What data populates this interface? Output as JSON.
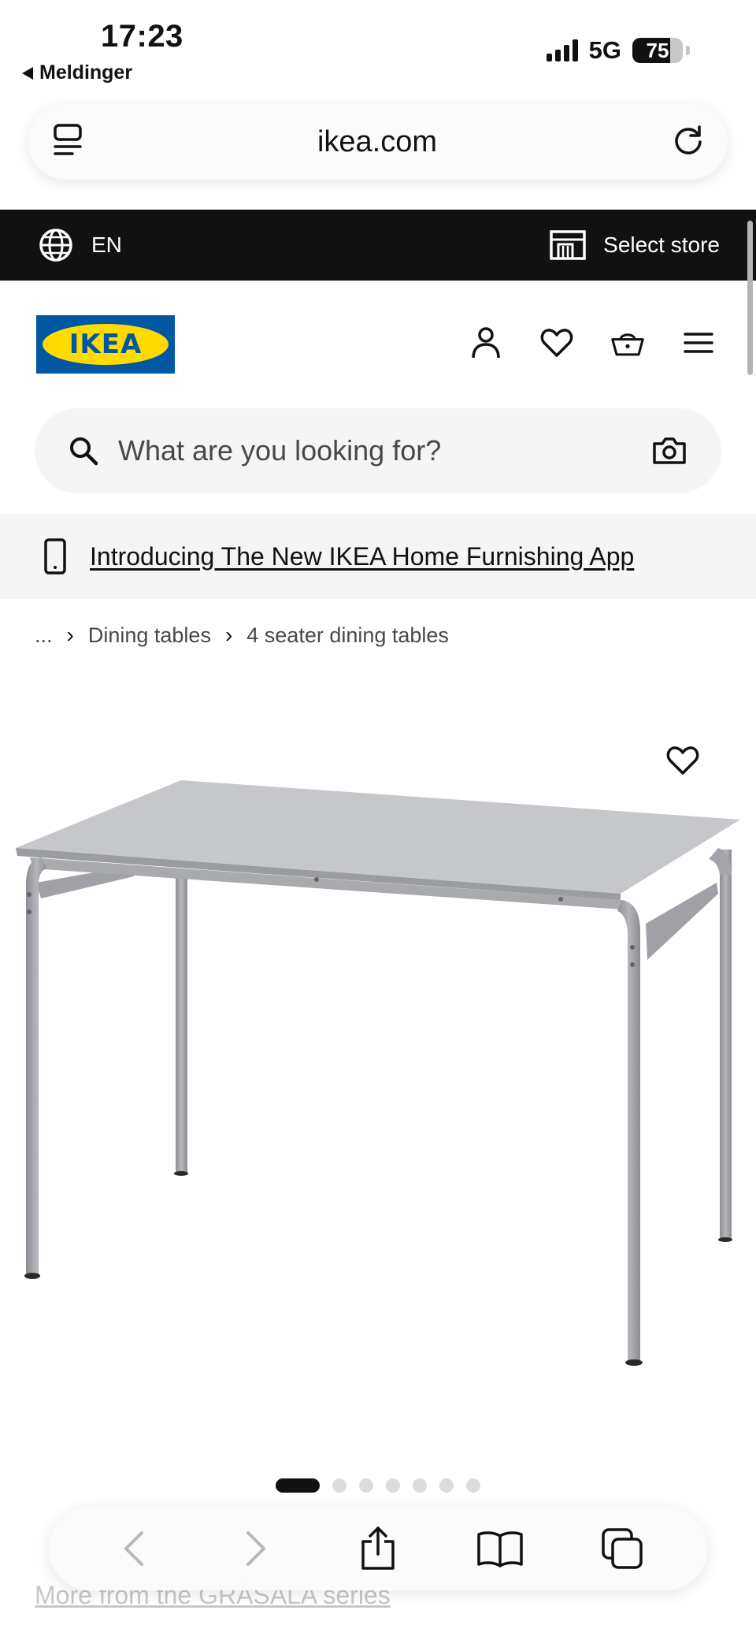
{
  "status_bar": {
    "time": "17:23",
    "back_label": "Meldinger",
    "network": "5G",
    "battery": "75",
    "battery_level": 0.75
  },
  "browser": {
    "url": "ikea.com"
  },
  "top_bar": {
    "language": "EN",
    "store_label": "Select store"
  },
  "header": {
    "logo_text": "IKEA",
    "icons": [
      "account-icon",
      "heart-icon",
      "basket-icon",
      "menu-icon"
    ]
  },
  "search": {
    "placeholder": "What are you looking for?"
  },
  "app_banner": {
    "text": "Introducing The New IKEA Home Furnishing App"
  },
  "breadcrumb": {
    "ellipsis": "...",
    "items": [
      "Dining tables",
      "4 seater dining tables"
    ]
  },
  "product": {
    "image_description_icon": "grey-table-image",
    "image_count": 7,
    "active_image": 1
  },
  "series_link": "More from the GRÅSALA series",
  "colors": {
    "topbar": "#111111",
    "ikea_blue": "#0058a3",
    "ikea_yellow": "#ffdb00",
    "light_bg": "#f5f5f5"
  }
}
